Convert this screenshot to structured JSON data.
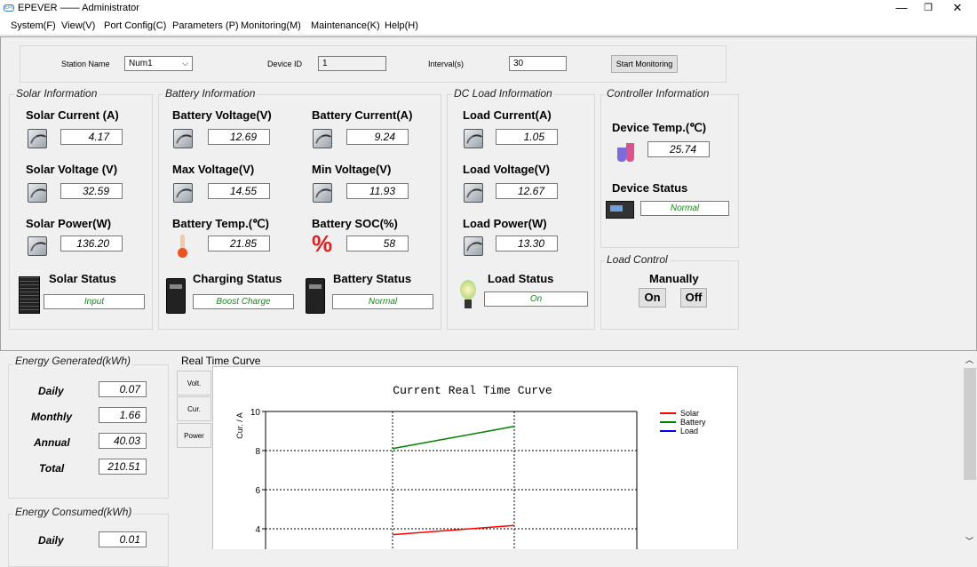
{
  "window": {
    "title": "EPEVER —— Administrator",
    "logo_text": "EPI",
    "min": "—",
    "restore": "❐",
    "close": "✕"
  },
  "menu": [
    "System(F)",
    "View(V)",
    "Port Config(C)",
    "Parameters (P)",
    "Monitoring(M)",
    "Maintenance(K)",
    "Help(H)"
  ],
  "station": {
    "label": "Station Name",
    "value": "Num1",
    "device_label": "Device ID",
    "device_value": "1",
    "interval_label": "Interval(s)",
    "interval_value": "30",
    "start_button": "Start Monitoring"
  },
  "solar": {
    "legend": "Solar Information",
    "current_label": "Solar Current (A)",
    "current": "4.17",
    "voltage_label": "Solar Voltage (V)",
    "voltage": "32.59",
    "power_label": "Solar Power(W)",
    "power": "136.20",
    "status_label": "Solar Status",
    "status": "Input"
  },
  "battery": {
    "legend": "Battery Information",
    "voltage_label": "Battery Voltage(V)",
    "voltage": "12.69",
    "current_label": "Battery Current(A)",
    "current": "9.24",
    "max_label": "Max Voltage(V)",
    "max": "14.55",
    "min_label": "Min Voltage(V)",
    "min": "11.93",
    "temp_label": "Battery Temp.(℃)",
    "temp": "21.85",
    "soc_label": "Battery SOC(%)",
    "soc": "58",
    "charging_label": "Charging Status",
    "charging": "Boost Charge",
    "status_label": "Battery Status",
    "status": "Normal"
  },
  "load": {
    "legend": "DC Load Information",
    "current_label": "Load Current(A)",
    "current": "1.05",
    "voltage_label": "Load Voltage(V)",
    "voltage": "12.67",
    "power_label": "Load Power(W)",
    "power": "13.30",
    "status_label": "Load Status",
    "status": "On"
  },
  "controller": {
    "legend": "Controller Information",
    "temp_label": "Device Temp.(℃)",
    "temp": "25.74",
    "status_label": "Device Status",
    "status": "Normal"
  },
  "load_control": {
    "legend": "Load Control",
    "manual_label": "Manually",
    "on": "On",
    "off": "Off"
  },
  "energy_generated": {
    "legend": "Energy Generated(kWh)",
    "daily_label": "Daily",
    "daily": "0.07",
    "monthly_label": "Monthly",
    "monthly": "1.66",
    "annual_label": "Annual",
    "annual": "40.03",
    "total_label": "Total",
    "total": "210.51"
  },
  "energy_consumed": {
    "legend": "Energy Consumed(kWh)",
    "daily_label": "Daily",
    "daily": "0.01"
  },
  "curve": {
    "legend": "Real Time Curve",
    "tabs": [
      "Volt.",
      "Cur.",
      "Power"
    ]
  },
  "colors": {
    "solar": "#ff0000",
    "battery": "#008000",
    "load": "#0000ff",
    "status_text": "#1a8a1a"
  },
  "chart_data": {
    "type": "line",
    "title": "Current Real Time Curve",
    "ylabel": "Cur. / A",
    "y_ticks": [
      4,
      6,
      8,
      10
    ],
    "ylim_visible": [
      3,
      10
    ],
    "series": [
      {
        "name": "Solar",
        "color": "#ff0000",
        "values": [
          3.7,
          4.17
        ]
      },
      {
        "name": "Battery",
        "color": "#008000",
        "values": [
          8.1,
          9.24
        ]
      },
      {
        "name": "Load",
        "color": "#0000ff",
        "values": []
      }
    ]
  }
}
